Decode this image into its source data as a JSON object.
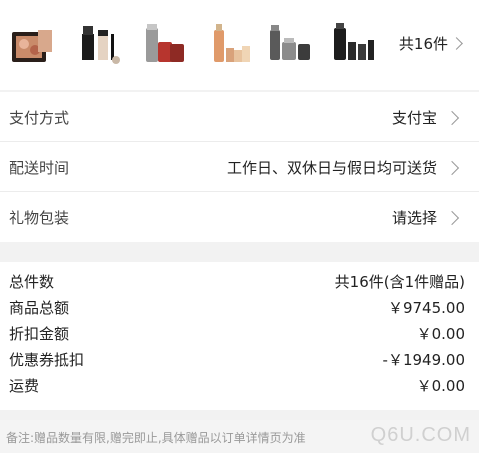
{
  "products": {
    "thumbnails": [
      {
        "icon": "makeup-palette-icon"
      },
      {
        "icon": "foundation-brushes-icon"
      },
      {
        "icon": "serum-bottles-icon"
      },
      {
        "icon": "perfume-set-icon"
      },
      {
        "icon": "skincare-set-icon"
      },
      {
        "icon": "dark-serum-set-icon"
      }
    ],
    "total_label": "共16件"
  },
  "options": {
    "payment": {
      "label": "支付方式",
      "value": "支付宝"
    },
    "delivery": {
      "label": "配送时间",
      "value": "工作日、双休日与假日均可送货"
    },
    "gift_wrap": {
      "label": "礼物包装",
      "value": "请选择"
    }
  },
  "summary": {
    "items": {
      "label": "总件数",
      "value": "共16件(含1件赠品)"
    },
    "goods_total": {
      "label": "商品总额",
      "value": "￥9745.00"
    },
    "discount": {
      "label": "折扣金额",
      "value": "￥0.00"
    },
    "coupon": {
      "label": "优惠券抵扣",
      "value": "-￥1949.00"
    },
    "shipping": {
      "label": "运费",
      "value": "￥0.00"
    }
  },
  "note": "备注:赠品数量有限,赠完即止,具体赠品以订单详情页为准",
  "watermark": "Q6U.COM",
  "colors": {
    "background": "#ffffff",
    "separator": "#f2f2f2",
    "text": "#222222",
    "muted": "#999999"
  }
}
